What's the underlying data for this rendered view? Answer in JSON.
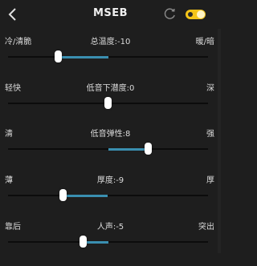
{
  "header": {
    "title": "MSEB",
    "back_icon": "chevron-left-icon",
    "reset_icon": "reset-icon",
    "toggle_on": true,
    "accent_color": "#f5c518"
  },
  "sliders": [
    {
      "left_label": "冷/清脆",
      "center_label": "总温度:-10",
      "right_label": "暖/暗",
      "value": -10,
      "range": [
        -20,
        20
      ]
    },
    {
      "left_label": "轻快",
      "center_label": "低音下潜度:0",
      "right_label": "深",
      "value": 0,
      "range": [
        -20,
        20
      ]
    },
    {
      "left_label": "清",
      "center_label": "低音弹性:8",
      "right_label": "强",
      "value": 8,
      "range": [
        -20,
        20
      ]
    },
    {
      "left_label": "薄",
      "center_label": "厚度:-9",
      "right_label": "厚",
      "value": -9,
      "range": [
        -20,
        20
      ]
    },
    {
      "left_label": "靠后",
      "center_label": "人声:-5",
      "right_label": "突出",
      "value": -5,
      "range": [
        -20,
        20
      ]
    }
  ],
  "fill_color": "#3a8fb0"
}
